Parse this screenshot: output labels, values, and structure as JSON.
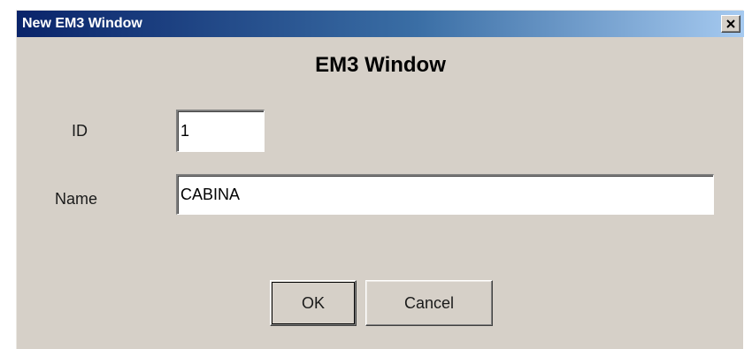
{
  "window": {
    "title": "New EM3 Window",
    "close_icon": "close-icon"
  },
  "form": {
    "heading": "EM3 Window",
    "id_label": "ID",
    "id_value": "1",
    "name_label": "Name",
    "name_value": "CABINA"
  },
  "buttons": {
    "ok_label": "OK",
    "cancel_label": "Cancel"
  },
  "colors": {
    "dialog_background": "#d6d0c8",
    "titlebar_start": "#0a246a",
    "titlebar_end": "#a6caf0"
  }
}
